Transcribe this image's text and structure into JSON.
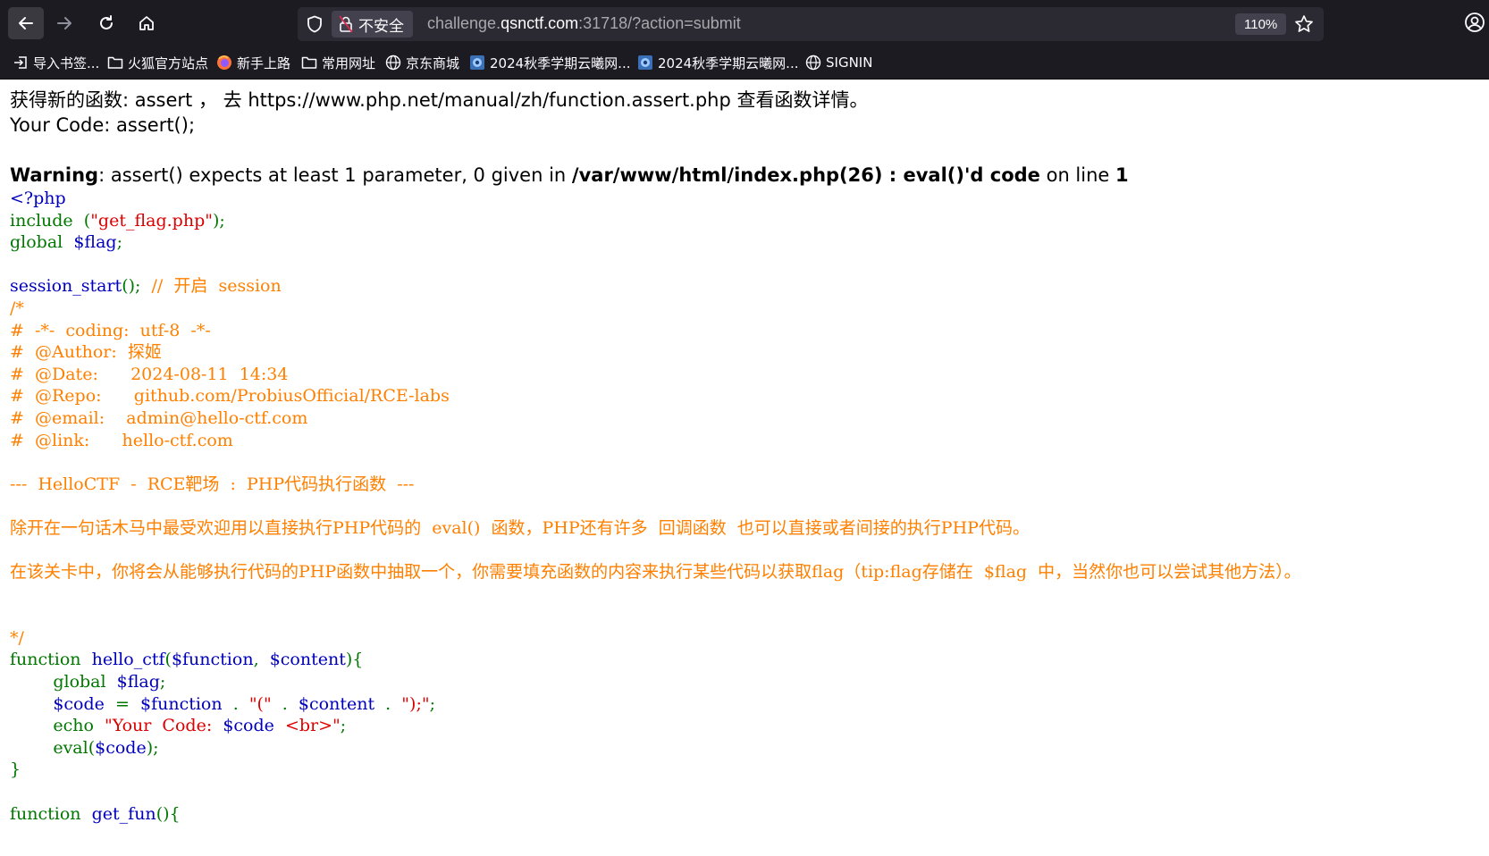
{
  "browser": {
    "security_label": "不安全",
    "url_host_prefix": "challenge.",
    "url_host_domain": "qsnctf.com",
    "url_rest": ":31718/?action=submit",
    "zoom": "110%"
  },
  "bookmarks": [
    {
      "label": "导入书签...",
      "icon": "import-icon"
    },
    {
      "label": "火狐官方站点",
      "icon": "folder-icon"
    },
    {
      "label": "新手上路",
      "icon": "firefox-icon"
    },
    {
      "label": "常用网址",
      "icon": "folder-icon"
    },
    {
      "label": "京东商城",
      "icon": "globe-icon"
    },
    {
      "label": "2024秋季学期云曦网...",
      "icon": "site-icon"
    },
    {
      "label": "2024秋季学期云曦网...",
      "icon": "site-icon"
    },
    {
      "label": "SIGNIN",
      "icon": "globe-icon"
    }
  ],
  "page": {
    "line1": "获得新的函数: assert ， 去 https://www.php.net/manual/zh/function.assert.php 查看函数详情。",
    "line2": "Your Code: assert();",
    "warning_label": "Warning",
    "warning_msg": ": assert() expects at least 1 parameter, 0 given in ",
    "warning_file": "/var/www/html/index.php(26) : eval()'d code",
    "warning_on_line": " on line ",
    "warning_line_no": "1"
  },
  "source": {
    "l01": "<?php",
    "l02a": "include  ",
    "l02b": "(",
    "l02c": "\"get_flag.php\"",
    "l02d": ");",
    "l03a": "global  ",
    "l03b": "$flag",
    "l03c": ";",
    "l05a": "session_start",
    "l05b": "();  ",
    "l05c": "//  开启  session",
    "l06": "/*",
    "l07": "#  -*-  coding:  utf-8  -*-",
    "l08": "#  @Author:  探姬",
    "l09": "#  @Date:      2024-08-11  14:34",
    "l10": "#  @Repo:      github.com/ProbiusOfficial/RCE-labs",
    "l11": "#  @email:    admin@hello-ctf.com",
    "l12": "#  @link:      hello-ctf.com",
    "l14": "---  HelloCTF  -  RCE靶场  :  PHP代码执行函数  ---",
    "l16": "除开在一句话木马中最受欢迎用以直接执行PHP代码的  eval()  函数，PHP还有许多  回调函数  也可以直接或者间接的执行PHP代码。",
    "l18": "在该关卡中，你将会从能够执行代码的PHP函数中抽取一个，你需要填充函数的内容来执行某些代码以获取flag（tip:flag存储在  $flag  中，当然你也可以尝试其他方法）。",
    "l21": "*/",
    "l22a": "function  ",
    "l22b": "hello_ctf",
    "l22c": "(",
    "l22d": "$function",
    "l22e": ",  ",
    "l22f": "$content",
    "l22g": "){",
    "l23a": "global  ",
    "l23b": "$flag",
    "l23c": ";",
    "l24a": "$code  ",
    "l24b": "=  ",
    "l24c": "$function  ",
    "l24d": ".  ",
    "l24e": "\"(\"  ",
    "l24f": ".  ",
    "l24g": "$content  ",
    "l24h": ".  ",
    "l24i": "\");\"",
    "l24j": ";",
    "l25a": "echo  ",
    "l25b": "\"Your  Code:  ",
    "l25c": "$code  ",
    "l25d": "<br>\"",
    "l25e": ";",
    "l26a": "eval",
    "l26b": "(",
    "l26c": "$code",
    "l26d": ");",
    "l27": "}",
    "l29a": "function  ",
    "l29b": "get_fun",
    "l29c": "(){"
  }
}
